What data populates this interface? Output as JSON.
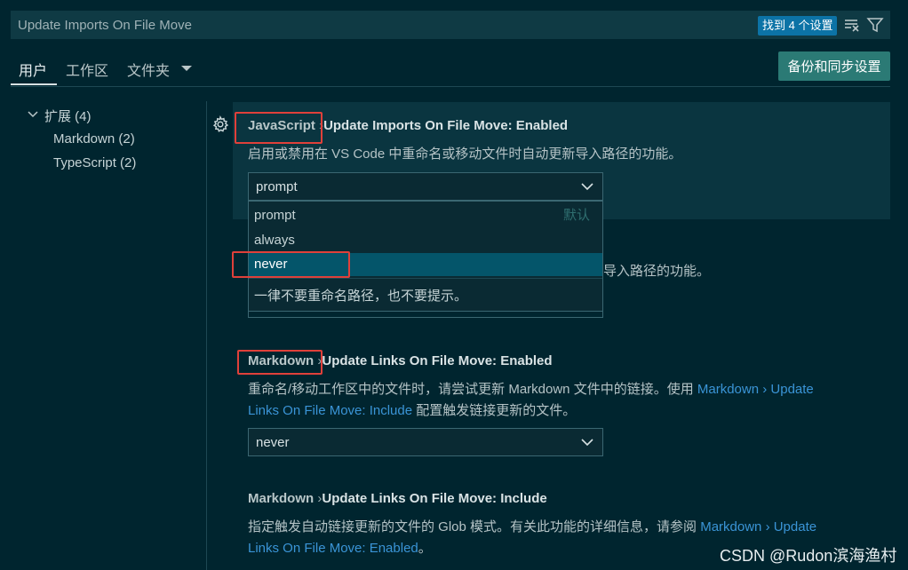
{
  "search": {
    "value": "Update Imports On File Move",
    "badge": "找到 4 个设置"
  },
  "tabs": {
    "user": "用户",
    "workspace": "工作区",
    "folder": "文件夹"
  },
  "sync_button": "备份和同步设置",
  "toc": {
    "extensions": "扩展 (4)",
    "markdown": "Markdown (2)",
    "typescript": "TypeScript (2)"
  },
  "settings": [
    {
      "prefix": "JavaScript",
      "sep": "›",
      "title_mid": "Update Imports On File Move: ",
      "title_bold": "Enabled",
      "desc": "启用或禁用在 VS Code 中重命名或移动文件时自动更新导入路径的功能。",
      "value": "prompt",
      "options": [
        "prompt",
        "always",
        "never"
      ],
      "default_label": "默认",
      "selected_option": "never",
      "option_desc": "一律不要重命名路径，也不要提示。"
    },
    {
      "desc_fragment": "导入路径的功能。"
    },
    {
      "prefix": "Markdown",
      "sep": "›",
      "title_mid": "Update Links On File Move: ",
      "title_bold": "Enabled",
      "desc_line1": "重命名/移动工作区中的文件时，请尝试更新 Markdown 文件中的链接。使用 ",
      "link1_line1": "Markdown › Update",
      "link1_line2": "Links On File Move: Include",
      "desc_line2": " 配置触发链接更新的文件。",
      "value": "never"
    },
    {
      "prefix": "Markdown",
      "sep": "›",
      "title_mid": "Update Links On File Move: ",
      "title_bold": "Include",
      "desc_line1": "指定触发自动链接更新的文件的 Glob 模式。有关此功能的详细信息，请参阅 ",
      "link1_line1": "Markdown › Update",
      "link1_line2": "Links On File Move: Enabled",
      "desc_line2": "。"
    }
  ],
  "watermark": "CSDN @Rudon滨海渔村",
  "colors": {
    "accent": "#0c73a6",
    "button": "#2b7a75",
    "highlight": "#e0403a",
    "link": "#3a94d6",
    "background": "#00252f"
  },
  "icons": {
    "clear": "clear-filter-icon",
    "filter": "filter-icon",
    "gear": "gear-icon",
    "chevron": "chevron-down-icon"
  }
}
